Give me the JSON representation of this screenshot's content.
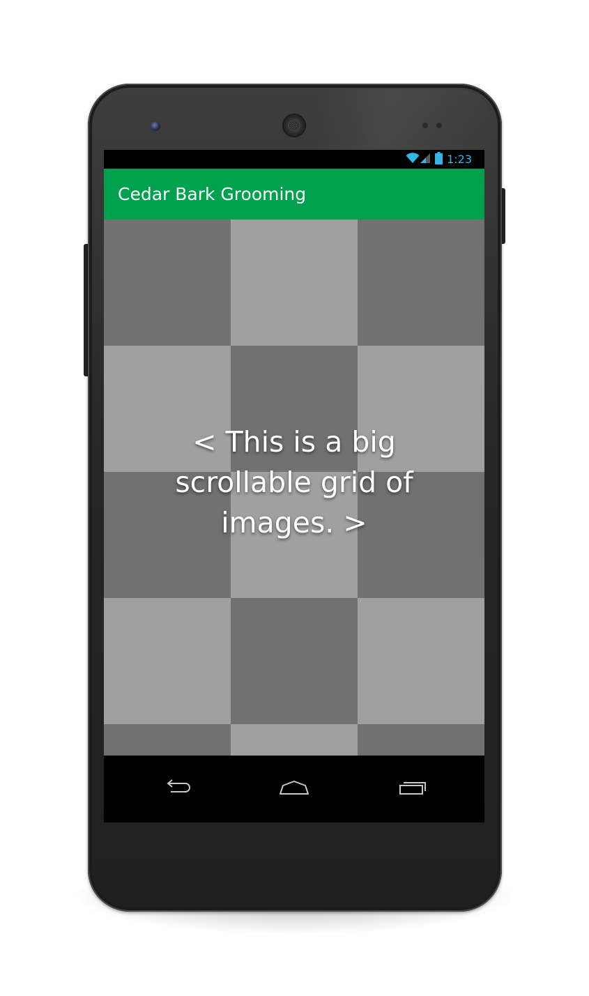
{
  "device": {
    "name": "android-phone-frame"
  },
  "status_bar": {
    "time": "1:23",
    "icons": [
      "wifi-icon",
      "cell-signal-icon",
      "battery-icon"
    ],
    "accent_color": "#33b5e5"
  },
  "app_bar": {
    "title": "Cedar Bark Grooming",
    "color": "#00a14e"
  },
  "grid": {
    "columns": 3,
    "tile_colors": [
      "#717171",
      "#a0a0a0"
    ],
    "overlay_text": "< This is a big scrollable grid of images. >"
  },
  "nav_bar": {
    "buttons": [
      "back-icon",
      "home-icon",
      "recent-apps-icon"
    ]
  }
}
